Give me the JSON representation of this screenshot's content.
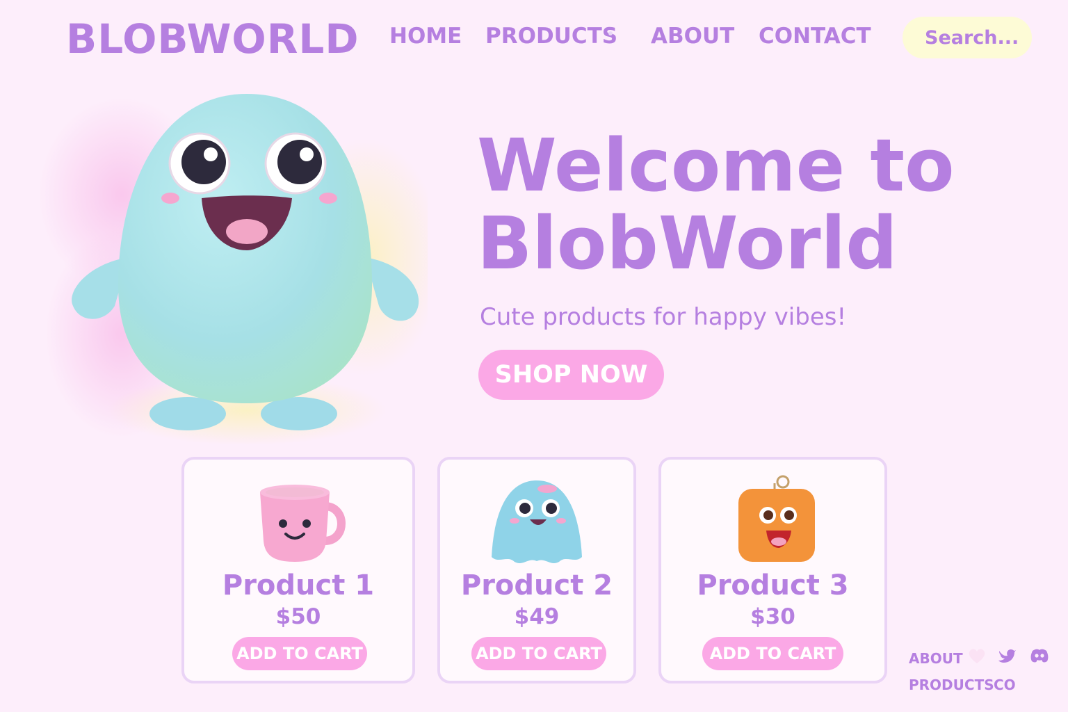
{
  "header": {
    "logo": "BLOBWORLD",
    "nav": [
      "HOME",
      "PRODUCTS",
      "ABOUT",
      "CONTACT"
    ],
    "search_placeholder": "Search..."
  },
  "hero": {
    "title": "Welcome to BlobWorld",
    "subtitle": "Cute products for happy vibes!",
    "cta_label": "SHOP NOW"
  },
  "products": [
    {
      "name": "Product 1",
      "price": "$50",
      "cart_label": "ADD TO CART",
      "icon": "pink-mug-icon"
    },
    {
      "name": "Product 2",
      "price": "$49",
      "cart_label": "ADD TO CART",
      "icon": "blue-ghost-icon"
    },
    {
      "name": "Product 3",
      "price": "$30",
      "cart_label": "ADD TO CART",
      "icon": "orange-keychain-icon"
    }
  ],
  "footer": {
    "links": [
      "ABOUT",
      "PRODUCTS",
      "CO"
    ],
    "social_icons": [
      "heart-icon",
      "bird-icon",
      "discord-icon"
    ]
  },
  "colors": {
    "background": "#fdeefb",
    "accent_purple": "#b57fe0",
    "button_pink": "#fba8e6",
    "search_yellow": "#fdfbd6",
    "card_border": "#ead4f6"
  }
}
